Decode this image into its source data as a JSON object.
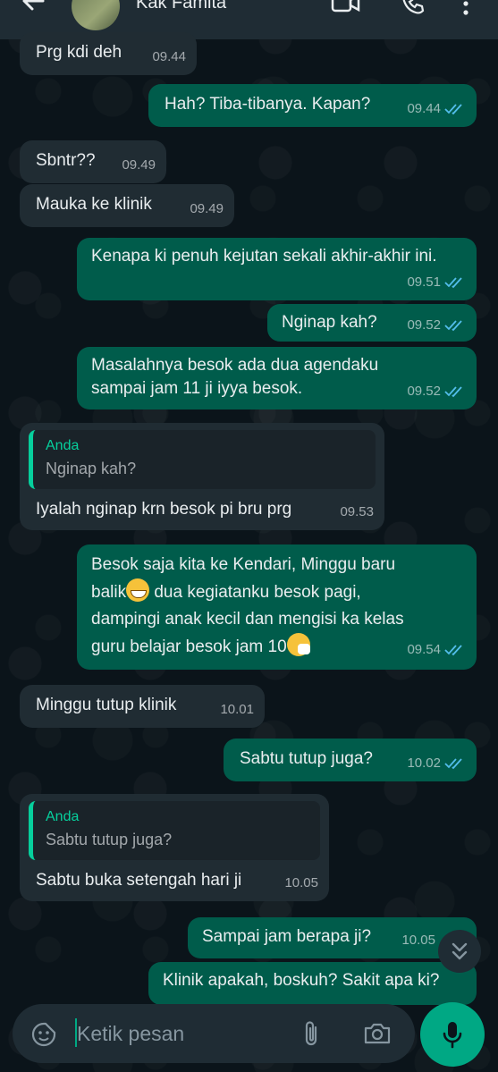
{
  "header": {
    "contact_name": "Kak Famita"
  },
  "messages": [
    {
      "text": "Prg kdi deh",
      "time": "09.44"
    },
    {
      "text": "Hah? Tiba-tibanya. Kapan?",
      "time": "09.44"
    },
    {
      "text": "Sbntr??",
      "time": "09.49"
    },
    {
      "text": "Mauka ke klinik",
      "time": "09.49"
    },
    {
      "text": "Kenapa ki penuh kejutan sekali akhir-akhir ini.",
      "time": "09.51"
    },
    {
      "text": "Nginap kah?",
      "time": "09.52"
    },
    {
      "line1": "Masalahnya besok ada dua agendaku",
      "line2": "sampai jam 11 ji iyya besok.",
      "time": "09.52"
    },
    {
      "quote_author": "Anda",
      "quote_text": "Nginap kah?",
      "text": "Iyalah nginap krn besok pi bru prg",
      "time": "09.53"
    },
    {
      "line1": "Besok saja kita ke Kendari, Minggu baru",
      "line2a": "balik",
      "line2b": " dua kegiatanku besok pagi,",
      "line3": "dampingi anak kecil dan mengisi ka kelas",
      "line4": "guru belajar besok jam 10",
      "time": "09.54"
    },
    {
      "text": "Minggu tutup klinik",
      "time": "10.01"
    },
    {
      "text": "Sabtu tutup juga?",
      "time": "10.02"
    },
    {
      "quote_author": "Anda",
      "quote_text": "Sabtu tutup juga?",
      "text": "Sabtu buka setengah hari ji",
      "time": "10.05"
    },
    {
      "text": "Sampai jam berapa ji?",
      "time": "10.05"
    },
    {
      "text": "Klinik apakah, boskuh? Sakit apa ki?"
    }
  ],
  "input": {
    "placeholder": "Ketik pesan"
  },
  "colors": {
    "background": "#0b141a",
    "incoming_bubble": "#202c33",
    "outgoing_bubble": "#005c4b",
    "read_tick": "#53bdeb",
    "accent": "#00a884"
  },
  "icons": [
    "back-arrow-icon",
    "video-call-icon",
    "phone-icon",
    "menu-dots-icon",
    "sticker-icon",
    "attach-icon",
    "camera-icon",
    "mic-icon",
    "chevron-double-down-icon"
  ]
}
